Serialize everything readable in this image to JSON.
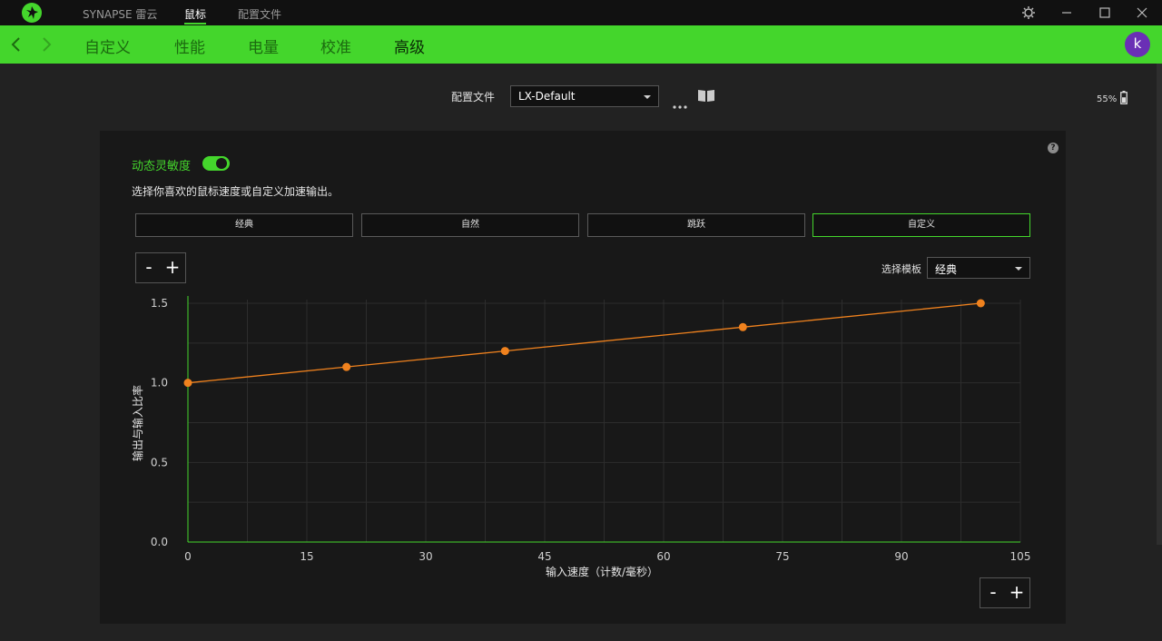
{
  "titlebar": {
    "tabs": [
      {
        "label": "SYNAPSE 雷云",
        "active": false
      },
      {
        "label": "鼠标",
        "active": true
      },
      {
        "label": "配置文件",
        "active": false
      }
    ],
    "icons": [
      "gear-icon",
      "minimize-icon",
      "maximize-icon",
      "close-icon"
    ]
  },
  "nav": {
    "tabs": [
      {
        "label": "自定义",
        "active": false
      },
      {
        "label": "性能",
        "active": false
      },
      {
        "label": "电量",
        "active": false
      },
      {
        "label": "校准",
        "active": false
      },
      {
        "label": "高级",
        "active": true
      }
    ],
    "avatar_letter": "k"
  },
  "profile": {
    "label": "配置文件",
    "value": "LX-Default"
  },
  "battery": {
    "text": "55%",
    "level": 0.55
  },
  "sensitivity": {
    "label": "动态灵敏度",
    "enabled": true,
    "description": "选择你喜欢的鼠标速度或自定义加速输出。",
    "presets": [
      {
        "label": "经典",
        "active": false
      },
      {
        "label": "自然",
        "active": false
      },
      {
        "label": "跳跃",
        "active": false
      },
      {
        "label": "自定义",
        "active": true
      }
    ],
    "template": {
      "label": "选择模板",
      "value": "经典"
    },
    "zoom": {
      "minus": "-",
      "plus": "+"
    }
  },
  "colors": {
    "accent": "#44d62c",
    "curve": "#f0821e",
    "panel": "#181818",
    "avatar": "#6a2fb5"
  },
  "chart_data": {
    "type": "line",
    "xlabel": "输入速度（计数/毫秒）",
    "ylabel": "输出与输入比率",
    "xlim": [
      0,
      105
    ],
    "ylim": [
      0,
      1.5
    ],
    "xticks": [
      0,
      15,
      30,
      45,
      60,
      75,
      90,
      105
    ],
    "yticks": [
      0.0,
      0.5,
      1.0,
      1.5
    ],
    "grid": true,
    "series": [
      {
        "x": [
          0,
          20,
          40,
          70,
          100
        ],
        "y": [
          1.0,
          1.1,
          1.2,
          1.35,
          1.5
        ]
      }
    ]
  }
}
